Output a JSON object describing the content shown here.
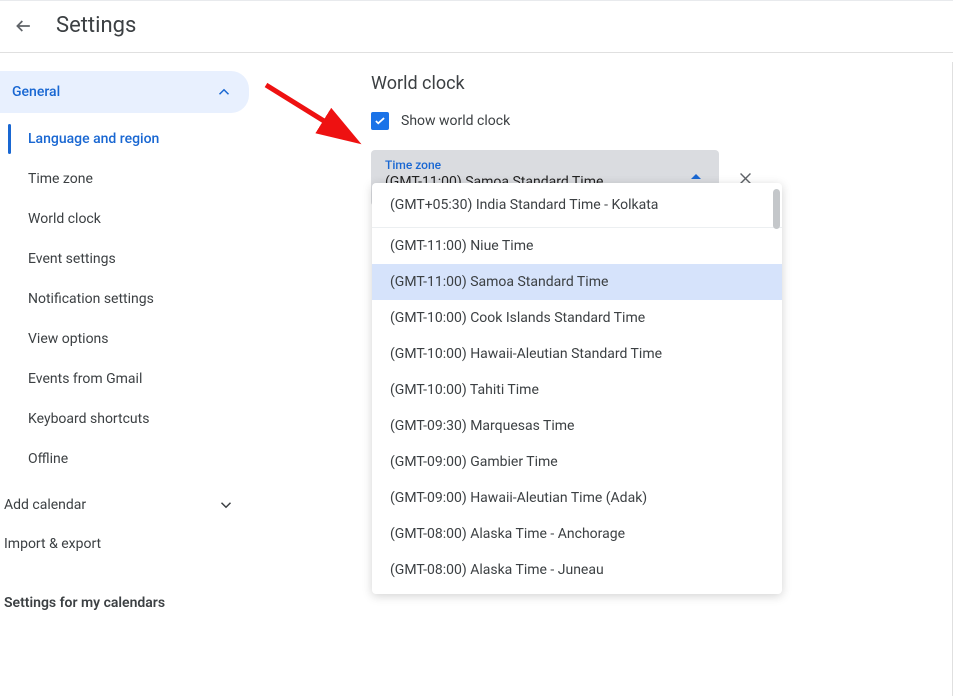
{
  "header": {
    "title": "Settings"
  },
  "sidebar": {
    "general_label": "General",
    "items": [
      "Language and region",
      "Time zone",
      "World clock",
      "Event settings",
      "Notification settings",
      "View options",
      "Events from Gmail",
      "Keyboard shortcuts",
      "Offline"
    ],
    "add_calendar": "Add calendar",
    "import_export": "Import & export",
    "my_calendars_label": "Settings for my calendars"
  },
  "main": {
    "heading": "World clock",
    "checkbox_label": "Show world clock",
    "select": {
      "float_label": "Time zone",
      "value": "(GMT-11:00) Samoa Standard Time"
    },
    "dropdown": {
      "current": "(GMT+05:30) India Standard Time - Kolkata",
      "options": [
        "(GMT-11:00) Niue Time",
        "(GMT-11:00) Samoa Standard Time",
        "(GMT-10:00) Cook Islands Standard Time",
        "(GMT-10:00) Hawaii-Aleutian Standard Time",
        "(GMT-10:00) Tahiti Time",
        "(GMT-09:30) Marquesas Time",
        "(GMT-09:00) Gambier Time",
        "(GMT-09:00) Hawaii-Aleutian Time (Adak)",
        "(GMT-08:00) Alaska Time - Anchorage",
        "(GMT-08:00) Alaska Time - Juneau"
      ],
      "selected_index": 1
    }
  }
}
